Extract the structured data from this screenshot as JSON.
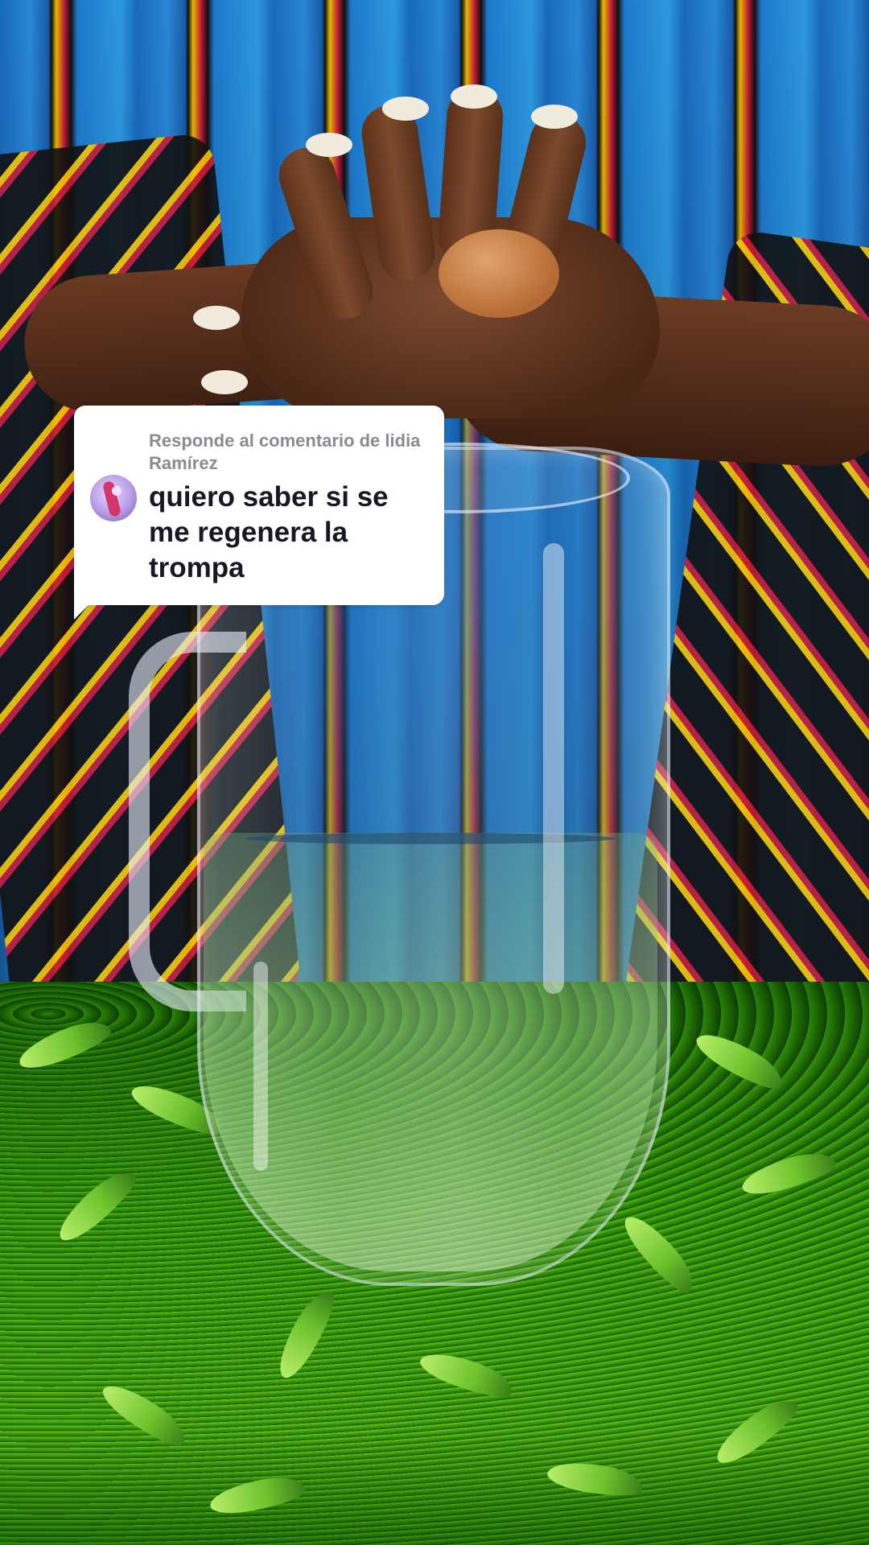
{
  "reply_card": {
    "header": "Responde al comentario de lidia Ramírez",
    "comment": "quiero saber si se me regenera la trompa",
    "avatar_icon": "user-avatar-icon"
  },
  "scene": {
    "description_icon": "glass-pitcher-with-water",
    "colors": {
      "card_bg": "#ffffff",
      "header_text": "#8a8b91",
      "comment_text": "#161823"
    }
  }
}
